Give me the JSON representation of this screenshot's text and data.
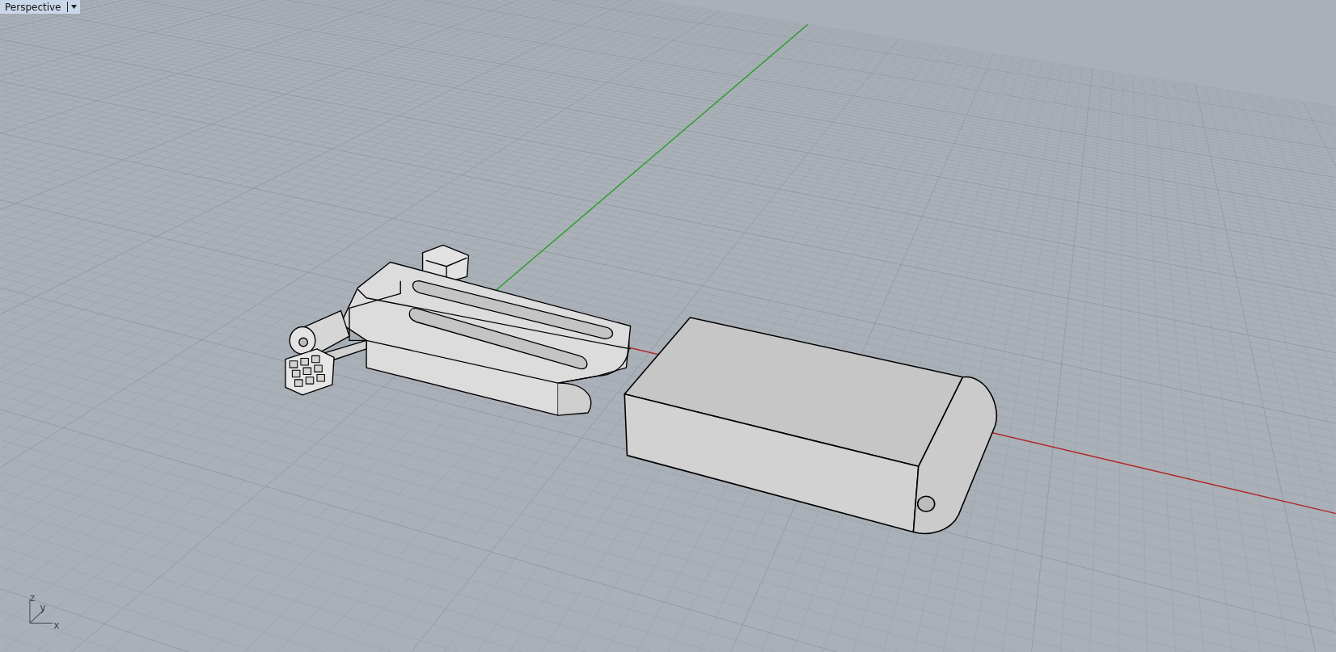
{
  "viewport": {
    "title": "Perspective",
    "active": true
  },
  "axis_labels": [
    "z",
    "y",
    "x"
  ]
}
